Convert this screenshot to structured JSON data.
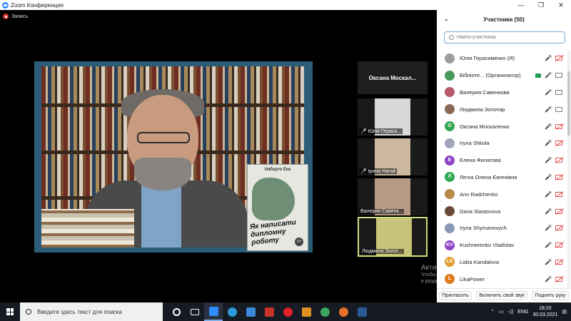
{
  "window": {
    "title": "Zoom Конференция",
    "controls": [
      "—",
      "❐",
      "✕"
    ]
  },
  "recording": {
    "label": "Запись"
  },
  "shared_content": {
    "book": {
      "author": "Умберто Еко",
      "title": "Як написати дипломну роботу",
      "badge": "07"
    }
  },
  "tiles": [
    {
      "name": "Оксана  Москал...",
      "label": "",
      "type": "name"
    },
    {
      "name": "",
      "label": "Юлія Гераси...",
      "type": "video",
      "muted": true,
      "color": "#d8d8d8"
    },
    {
      "name": "",
      "label": "Ірина Нагай",
      "type": "video",
      "muted": true,
      "color": "#cbb89e"
    },
    {
      "name": "",
      "label": "Валерия Савенк...",
      "type": "video",
      "muted": false,
      "color": "#b79a86"
    },
    {
      "name": "",
      "label": "Людмила Золот...",
      "type": "video",
      "muted": false,
      "color": "#c9c27a"
    }
  ],
  "participants": {
    "header": "Участники (50)",
    "search_placeholder": "Найти участника",
    "items": [
      {
        "name": "Юлія Герасименко (Я)",
        "avatar": "",
        "color": "#9e9e9e",
        "mic": "off",
        "cam": "off"
      },
      {
        "name": "Бібліоте... (Организатор)",
        "avatar": "",
        "color": "#4a9a5e",
        "mic": "on",
        "cam": "on"
      },
      {
        "name": "Валерия Савенкова",
        "avatar": "",
        "color": "#b45a6a",
        "mic": "on",
        "cam": "on"
      },
      {
        "name": "Людмила Золотар",
        "avatar": "",
        "color": "#8a6a58",
        "mic": "on",
        "cam": "on"
      },
      {
        "name": "Оксана Москаленко",
        "avatar": "O",
        "color": "#2fa84f",
        "mic": "off",
        "cam": "off"
      },
      {
        "name": "Iryna Shkola",
        "avatar": "",
        "color": "#a0a4b8",
        "mic": "off",
        "cam": "off"
      },
      {
        "name": "Елена Филатова",
        "avatar": "E",
        "color": "#8e44c8",
        "mic": "off",
        "cam": "off"
      },
      {
        "name": "Легка Олена Євгенівна",
        "avatar": "Л",
        "color": "#2fa84f",
        "mic": "off",
        "cam": "off"
      },
      {
        "name": "Ann Radchenko",
        "avatar": "",
        "color": "#b88a4a",
        "mic": "off",
        "cam": "off"
      },
      {
        "name": "Daria Slastonova",
        "avatar": "",
        "color": "#6a4a3a",
        "mic": "off",
        "cam": "off"
      },
      {
        "name": "Iryna Shymanovych",
        "avatar": "",
        "color": "#8a9ab8",
        "mic": "off",
        "cam": "off"
      },
      {
        "name": "Kushnerenko Vladislav",
        "avatar": "KV",
        "color": "#8e44c8",
        "mic": "off",
        "cam": "off"
      },
      {
        "name": "Lidiia Kandalova",
        "avatar": "LK",
        "color": "#e0a030",
        "mic": "off",
        "cam": "off"
      },
      {
        "name": "LikaPower",
        "avatar": "L",
        "color": "#e07a20",
        "mic": "off",
        "cam": "off"
      }
    ],
    "footer": {
      "invite": "Пригласить",
      "unmute": "Включить свой звук",
      "raise_hand": "Поднять руку"
    }
  },
  "watermark": {
    "title": "Активация Windows",
    "line1": "Чтобы активировать Windows, перейдите",
    "line2": "в раздел \"Параметры\"."
  },
  "taskbar": {
    "search_placeholder": "Введите здесь текст для поиска",
    "apps": [
      {
        "name": "cortana",
        "color": "#ffffff"
      },
      {
        "name": "task-view",
        "color": "#ffffff"
      },
      {
        "name": "zoom",
        "color": "#2d8cff"
      },
      {
        "name": "edge",
        "color": "#2a9bd8"
      },
      {
        "name": "store",
        "color": "#3a8ad8"
      },
      {
        "name": "powerpoint",
        "color": "#c9342a"
      },
      {
        "name": "opera",
        "color": "#e0202a"
      },
      {
        "name": "paint",
        "color": "#e09020"
      },
      {
        "name": "chrome",
        "color": "#3ba55c"
      },
      {
        "name": "firefox",
        "color": "#e8702a"
      },
      {
        "name": "word",
        "color": "#2b5797"
      }
    ],
    "language": "ENG",
    "time": "18:20",
    "date": "30.03.2021"
  }
}
